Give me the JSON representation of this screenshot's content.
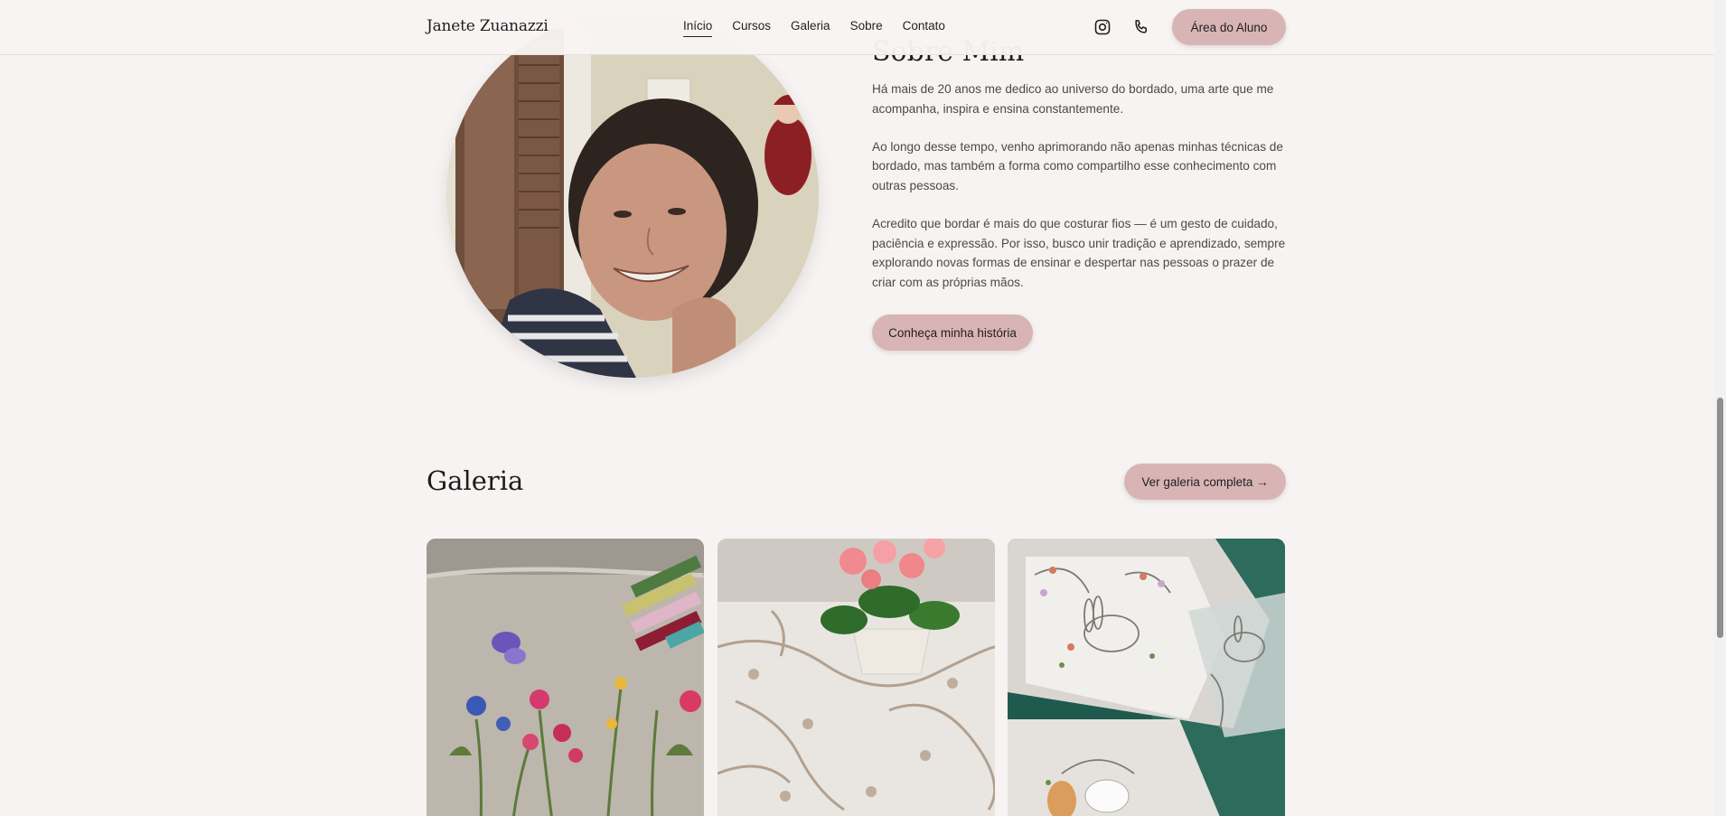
{
  "header": {
    "brand": "Janete Zuanazzi",
    "nav": [
      {
        "label": "Início",
        "active": true
      },
      {
        "label": "Cursos",
        "active": false
      },
      {
        "label": "Galeria",
        "active": false
      },
      {
        "label": "Sobre",
        "active": false
      },
      {
        "label": "Contato",
        "active": false
      }
    ],
    "icons": [
      "instagram-icon",
      "phone-icon"
    ],
    "cta_label": "Área do Aluno"
  },
  "sobre": {
    "title": "Sobre Mim",
    "paragraphs": [
      "Há mais de 20 anos me dedico ao universo do bordado, uma arte que me acompanha, inspira e ensina constantemente.",
      "Ao longo desse tempo, venho aprimorando não apenas minhas técnicas de bordado, mas também a forma como compartilho esse conhecimento com outras pessoas.",
      "Acredito que bordar é mais do que costurar fios — é um gesto de cuidado, paciência e expressão. Por isso, busco unir tradição e aprendizado, sempre explorando novas formas de ensinar e despertar nas pessoas o prazer de criar com as próprias mãos."
    ],
    "button_label": "Conheça minha história"
  },
  "galeria": {
    "title": "Galeria",
    "button_label": "Ver galeria completa →"
  },
  "colors": {
    "background": "#f7f3f2",
    "accent": "#d9b4b4",
    "text": "#1c1c1c"
  }
}
